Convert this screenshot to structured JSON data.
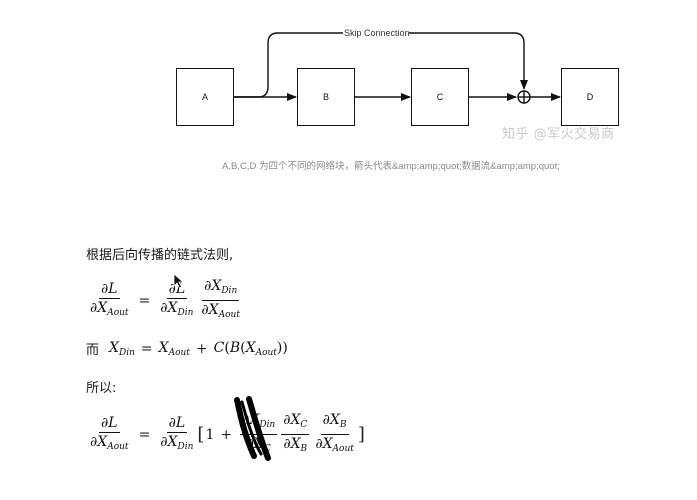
{
  "diagram": {
    "boxes": [
      "A",
      "B",
      "C",
      "D"
    ],
    "skip_label": "Skip Connection",
    "caption": "A,B,C,D 为四个不同的网络块，箭头代表&amp;amp;quot;数据流&amp;amp;quot;",
    "watermark": "知乎 @军火交易商"
  },
  "text": {
    "chain_rule_intro": "根据后向传播的链式法则,",
    "er": "而",
    "suoyi": "所以:"
  },
  "math": {
    "partial": "∂",
    "L": "L",
    "X": "X",
    "sub_aout": "Aout",
    "sub_din": "Din",
    "sub_c": "C",
    "sub_b": "B",
    "equals": "=",
    "plus": "+",
    "one": "1",
    "C": "C",
    "B": "B",
    "lbracket": "[",
    "rbracket": "]"
  }
}
